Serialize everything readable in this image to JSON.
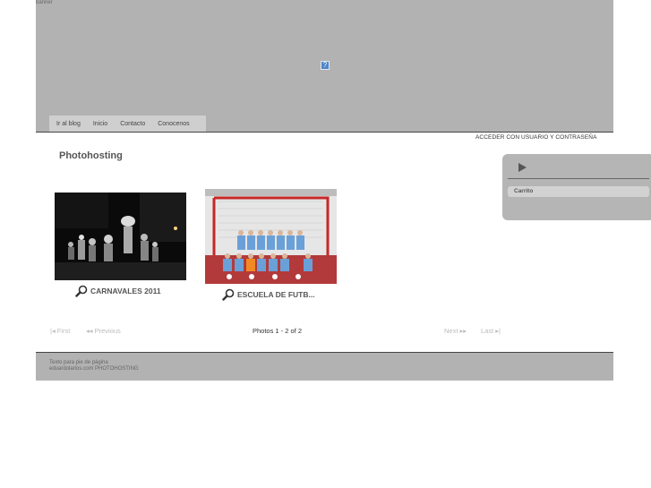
{
  "banner": {
    "label": "banner",
    "image_glyph": "?"
  },
  "nav": {
    "items": [
      "Ir al blog",
      "Inicio",
      "Contacto",
      "Conocenos"
    ]
  },
  "login_link": "ACCEDER CON USUARIO Y CONTRASEÑA",
  "page_title": "Photohosting",
  "side_panel": {
    "icon": "play-icon",
    "items": [
      "Carrito"
    ]
  },
  "photos": [
    {
      "caption": "CARNAVALES 2011"
    },
    {
      "caption": "ESCUELA DE FUTB..."
    }
  ],
  "pager": {
    "first": "First",
    "previous": "Previous",
    "info": "Photos 1 - 2 of 2",
    "next": "Next",
    "last": "Last"
  },
  "footer": {
    "line1": "Texto para pie de página",
    "line2": "eduardolarios.com PHOTOHOSTING"
  },
  "colors": {
    "banner": "#b2b2b2",
    "nav": "#cfcfcf",
    "panel": "#b5b5b5"
  }
}
